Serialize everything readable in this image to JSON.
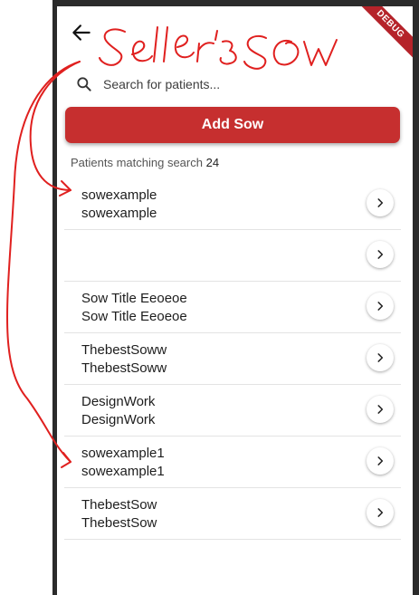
{
  "header": {
    "annotation_title": "Seller's SOW",
    "debug_label": "DEBUG"
  },
  "search": {
    "placeholder": "Search for patients..."
  },
  "add_button": {
    "label": "Add Sow"
  },
  "match": {
    "label": "Patients matching search",
    "count": "24"
  },
  "items": [
    {
      "title": "sowexample",
      "subtitle": "sowexample"
    },
    {
      "title": "",
      "subtitle": ""
    },
    {
      "title": "Sow Title Eeoeoe",
      "subtitle": "Sow Title Eeoeoe"
    },
    {
      "title": "ThebestSoww",
      "subtitle": "ThebestSoww"
    },
    {
      "title": "DesignWork",
      "subtitle": "DesignWork"
    },
    {
      "title": "sowexample1",
      "subtitle": "sowexample1"
    },
    {
      "title": "ThebestSow",
      "subtitle": "ThebestSow"
    }
  ],
  "colors": {
    "accent": "#c62f2f",
    "frame": "#2b2b2b",
    "annotation": "#e0201f"
  },
  "icons": {
    "back": "arrow-left-icon",
    "search": "search-icon",
    "chevron": "chevron-right-icon"
  }
}
